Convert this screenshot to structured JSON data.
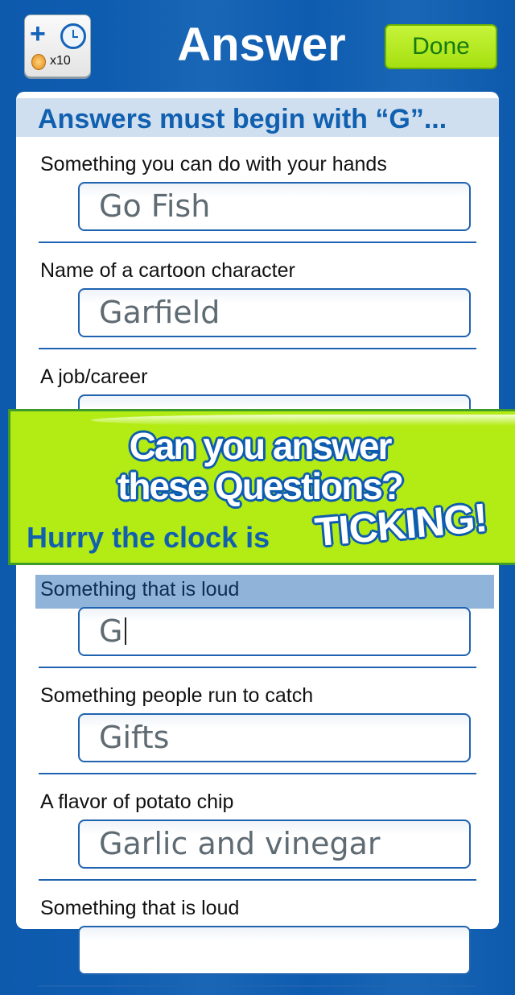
{
  "header": {
    "timer_button": {
      "icon": "add-time-clock-icon",
      "coin_icon": "coin-icon",
      "cost": "x10"
    },
    "title": "Answer",
    "done_label": "Done"
  },
  "instruction": "Answers must begin with “G”...",
  "rows_top": [
    {
      "question": "Something you can do with your hands",
      "answer": "Go Fish"
    },
    {
      "question": "Name of a cartoon character",
      "answer": "Garfield"
    },
    {
      "question": "A job/career",
      "answer": ""
    }
  ],
  "rows_bottom": [
    {
      "question": "Something that is loud",
      "answer": "G",
      "active": true
    },
    {
      "question": "Something people run to catch",
      "answer": "Gifts"
    },
    {
      "question": "A flavor of potato chip",
      "answer": "Garlic and vinegar"
    },
    {
      "question": "Something that is loud",
      "answer": ""
    }
  ],
  "banner": {
    "line1": "Can you answer",
    "line2": "these Questions?",
    "line3": "Hurry the clock is",
    "emphasis": "TICKING!"
  },
  "colors": {
    "background": "#0e5cb0",
    "accent_green": "#b3ec14",
    "text_blue": "#1160b0"
  }
}
